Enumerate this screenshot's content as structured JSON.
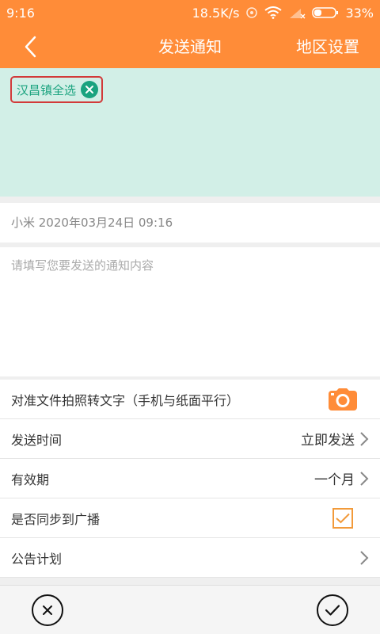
{
  "status": {
    "time": "9:16",
    "network_speed": "18.5K/s",
    "battery": "33%"
  },
  "header": {
    "title": "发送通知",
    "action": "地区设置"
  },
  "tags": [
    {
      "label": "汉昌镇全选"
    }
  ],
  "meta": {
    "text": "小米 2020年03月24日 09:16"
  },
  "content": {
    "placeholder": "请填写您要发送的通知内容",
    "value": ""
  },
  "rows": {
    "ocr": {
      "label": "对准文件拍照转文字（手机与纸面平行）"
    },
    "send_time": {
      "label": "发送时间",
      "value": "立即发送"
    },
    "validity": {
      "label": "有效期",
      "value": "一个月"
    },
    "broadcast_sync": {
      "label": "是否同步到广播",
      "checked": true
    },
    "plan": {
      "label": "公告计划"
    }
  },
  "colors": {
    "accent": "#ff8c38",
    "tag_green": "#1aa37f",
    "tag_border": "#d23a3a",
    "tag_area_bg": "#d2efe7",
    "checkbox": "#f29a3a"
  },
  "icons": {
    "back": "chevron-left-icon",
    "tag_close": "close-circle-icon",
    "camera": "camera-icon",
    "chevron": "chevron-right-icon",
    "check": "check-icon",
    "cancel": "close-circle-outline-icon",
    "confirm": "check-circle-outline-icon"
  }
}
